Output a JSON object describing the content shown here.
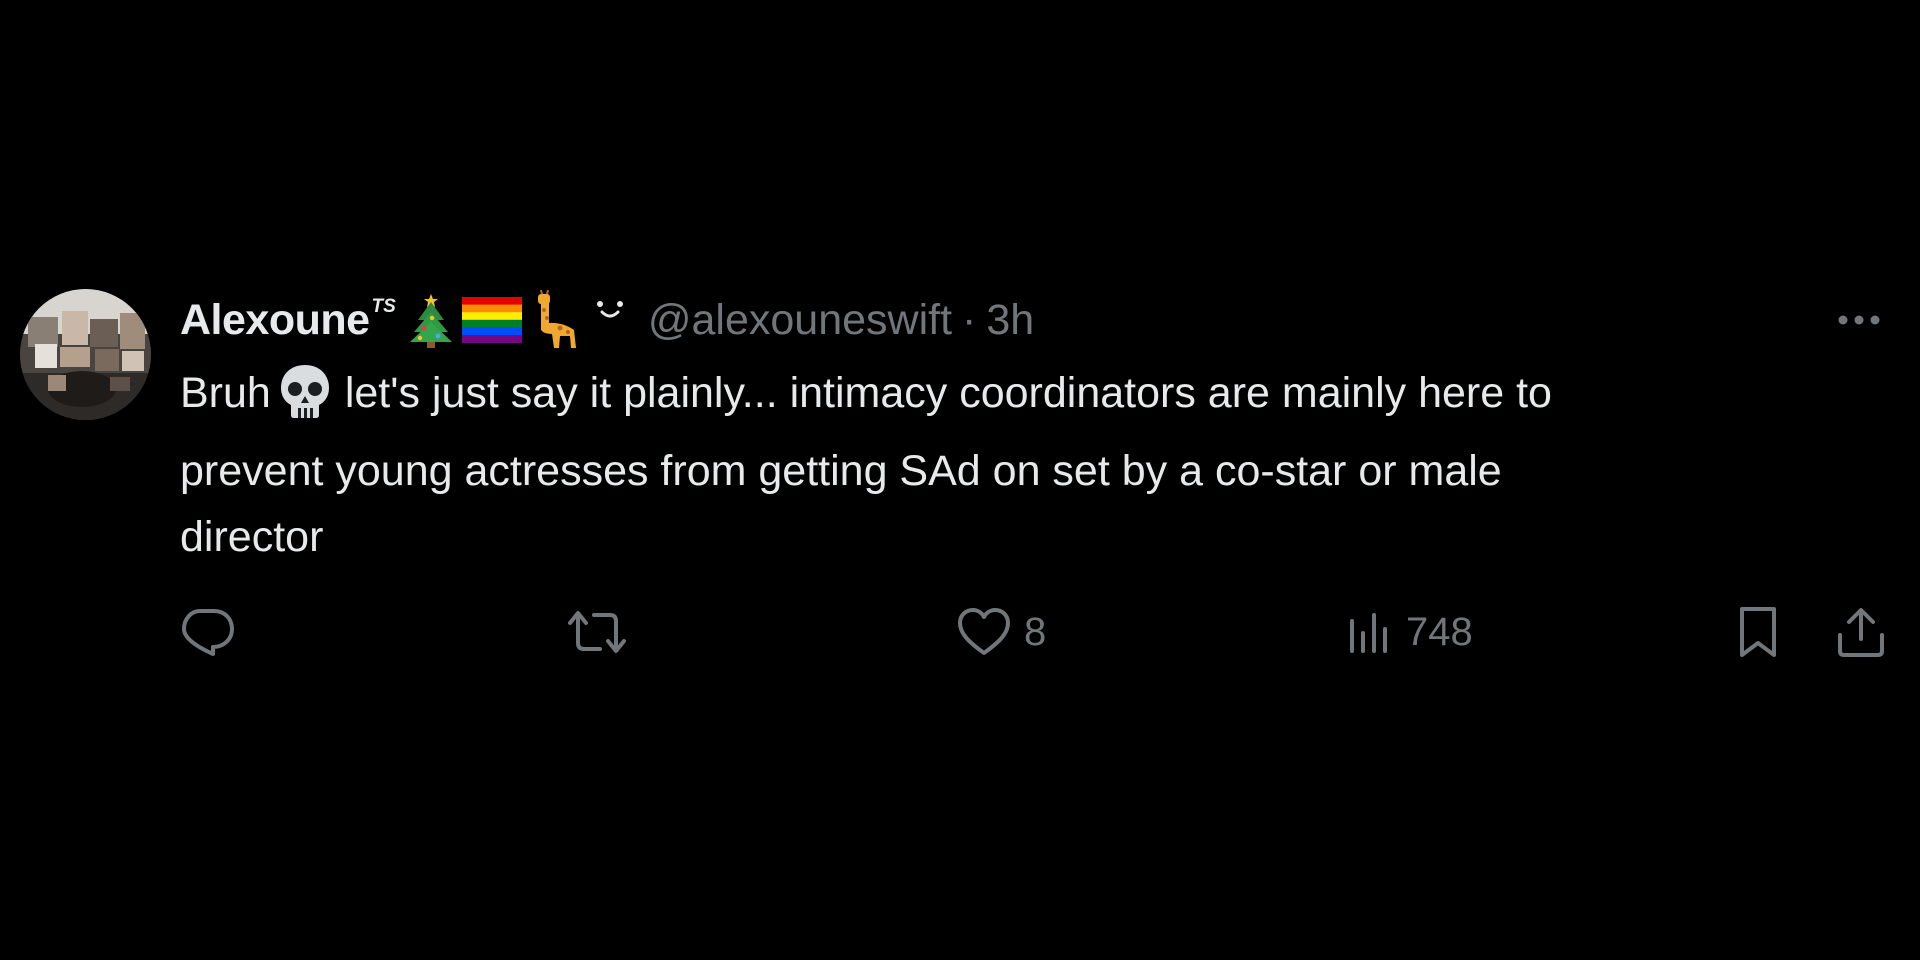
{
  "tweet": {
    "display_name": "Alexoune",
    "name_superscript": "TS",
    "name_emojis": [
      "christmas-tree",
      "rainbow-flag",
      "giraffe",
      "smiling-face"
    ],
    "handle": "@alexouneswift",
    "separator": "·",
    "time": "3h",
    "body_lines": [
      "Bruh",
      "let's just say it plainly... intimacy coordinators are mainly here to",
      "prevent young actresses from getting SAd on set by a co-star or male",
      "director"
    ],
    "body_emoji": "skull",
    "actions": {
      "reply_count": "",
      "repost_count": "",
      "like_count": "8",
      "views_count": "748"
    }
  },
  "colors": {
    "background": "#000000",
    "primary_text": "#e7e9ea",
    "secondary_text": "#71767b"
  }
}
